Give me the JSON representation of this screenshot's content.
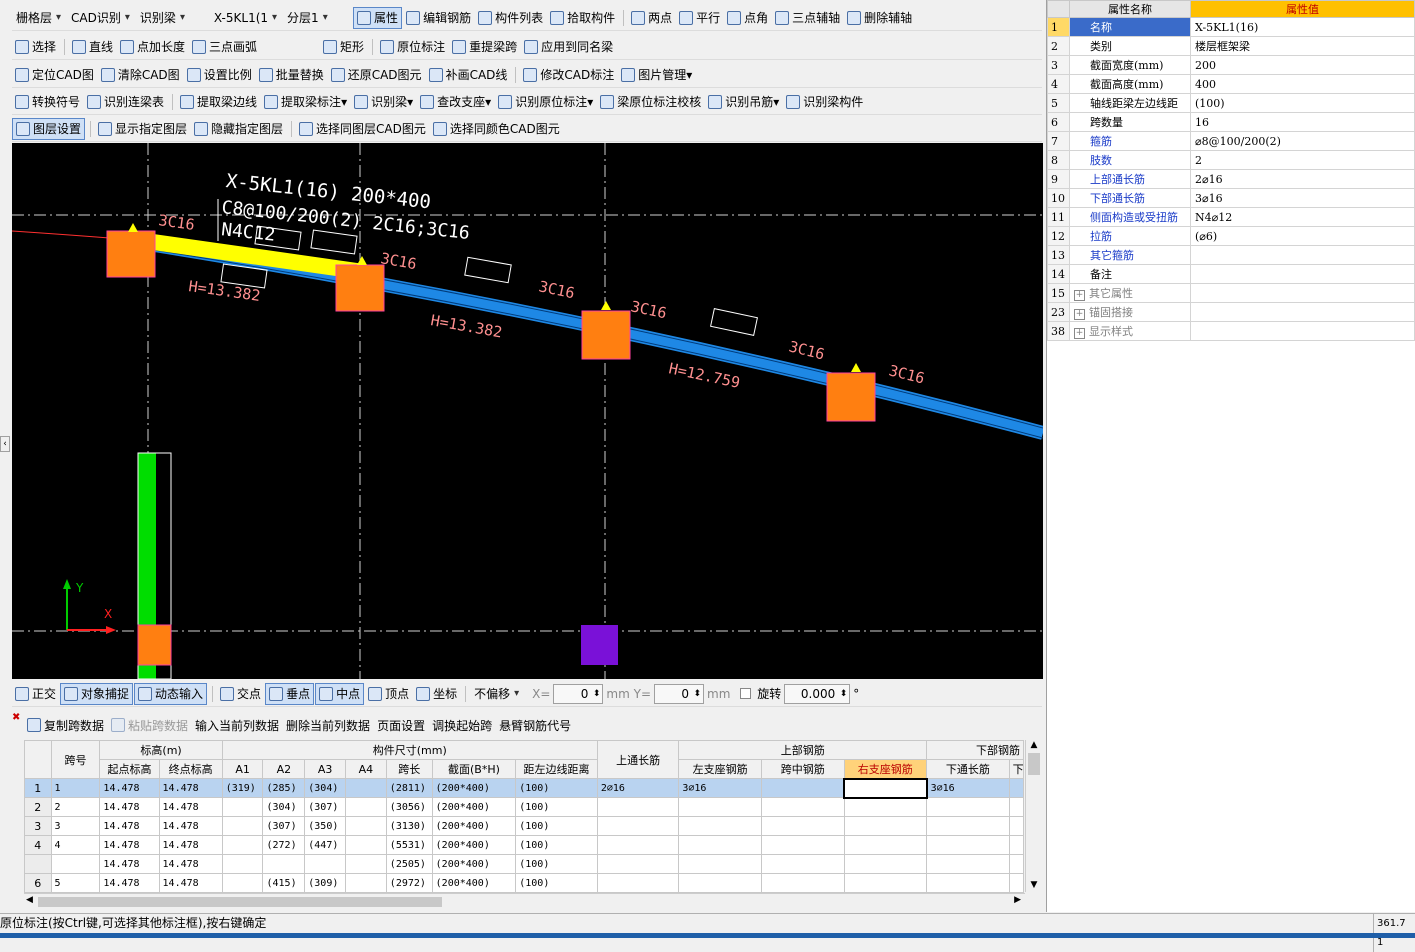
{
  "toolbar1": {
    "floor_group": "栅格层",
    "cad_recognize": "CAD识别",
    "recognize_beam": "识别梁",
    "component": "X-5KL1(1",
    "sublayer": "分层1",
    "attributes": "属性",
    "edit_rebar": "编辑钢筋",
    "component_list": "构件列表",
    "pick_component": "拾取构件",
    "two_points": "两点",
    "parallel": "平行",
    "point_angle": "点角",
    "three_point_axis": "三点辅轴",
    "delete_axis": "删除辅轴"
  },
  "toolbar2": {
    "select": "选择",
    "line": "直线",
    "point_length": "点加长度",
    "three_point_arc": "三点画弧",
    "rect": "矩形",
    "original_mark": "原位标注",
    "re_extract_span": "重提梁跨",
    "apply_same_name": "应用到同名梁"
  },
  "toolbar3": {
    "locate_cad": "定位CAD图",
    "clear_cad": "清除CAD图",
    "set_scale": "设置比例",
    "batch_replace": "批量替换",
    "restore_cad": "还原CAD图元",
    "redraw_cad_line": "补画CAD线",
    "modify_cad_mark": "修改CAD标注",
    "image_manage": "图片管理"
  },
  "toolbar4": {
    "convert_symbol": "转换符号",
    "recognize_continuous": "识别连梁表",
    "extract_beam_edge": "提取梁边线",
    "extract_beam_mark": "提取梁标注",
    "recognize_beam": "识别梁",
    "check_support": "查改支座",
    "recognize_original": "识别原位标注",
    "beam_check": "梁原位标注校核",
    "recognize_hanger": "识别吊筋",
    "recognize_beam_comp": "识别梁构件"
  },
  "toolbar5": {
    "layer_settings": "图层设置",
    "show_layer": "显示指定图层",
    "hide_layer": "隐藏指定图层",
    "select_same_layer": "选择同图层CAD图元",
    "select_same_color": "选择同颜色CAD图元"
  },
  "cad": {
    "beam_title": "X-5KL1(16) 200*400",
    "stirrup": "C8@100/200(2) 2C16;3C16",
    "side_bars": "N4C12",
    "mark_3c16": "3C16",
    "h1": "H=13.382",
    "h2": "H=13.382",
    "h3": "H=12.759",
    "axis_y": "Y",
    "axis_x": "X",
    "colors": {
      "beam_blue": "#1e88e5",
      "beam_yellow": "#ffff00",
      "column": "#ff7f11",
      "green": "#00dd00",
      "purple": "#7a11d8",
      "text_red": "#ff8080"
    }
  },
  "snapbar": {
    "orthogonal": "正交",
    "object_snap": "对象捕捉",
    "dynamic_input": "动态输入",
    "intersection": "交点",
    "perpendicular": "垂点",
    "midpoint": "中点",
    "vertex": "顶点",
    "coordinate": "坐标",
    "offset": "不偏移",
    "x_label": "X=",
    "x_val": "0",
    "y_label": "Y=",
    "y_val": "0",
    "unit": "mm",
    "rotate": "旋转",
    "rotate_val": "0.000",
    "deg": "°"
  },
  "gridbar": {
    "copy": "复制跨数据",
    "paste": "粘贴跨数据",
    "input_col": "输入当前列数据",
    "delete_col": "删除当前列数据",
    "page_setup": "页面设置",
    "adjust_start": "调换起始跨",
    "cantilever": "悬臂钢筋代号"
  },
  "grid": {
    "headers": {
      "span": "跨号",
      "elevation": "标高(m)",
      "start_elev": "起点标高",
      "end_elev": "终点标高",
      "size": "构件尺寸(mm)",
      "a1": "A1",
      "a2": "A2",
      "a3": "A3",
      "a4": "A4",
      "span_len": "跨长",
      "section": "截面(B*H)",
      "left_dist": "距左边线距离",
      "top_long": "上通长筋",
      "top_bars": "上部钢筋",
      "left_support": "左支座钢筋",
      "mid_span": "跨中钢筋",
      "right_support": "右支座钢筋",
      "bottom_bars": "下部钢筋",
      "bottom_long": "下通长筋",
      "next": "下"
    },
    "rows": [
      {
        "n": "1",
        "span": "1",
        "s": "14.478",
        "e": "14.478",
        "a1": "(319)",
        "a2": "(285)",
        "a3": "(304)",
        "a4": "",
        "len": "(2811)",
        "sec": "(200*400)",
        "dist": "(100)",
        "top": "2⌀16",
        "left": "3⌀16",
        "mid": "",
        "right": "",
        "bot": "3⌀16"
      },
      {
        "n": "2",
        "span": "2",
        "s": "14.478",
        "e": "14.478",
        "a1": "",
        "a2": "(304)",
        "a3": "(307)",
        "a4": "",
        "len": "(3056)",
        "sec": "(200*400)",
        "dist": "(100)",
        "top": "",
        "left": "",
        "mid": "",
        "right": "",
        "bot": ""
      },
      {
        "n": "3",
        "span": "3",
        "s": "14.478",
        "e": "14.478",
        "a1": "",
        "a2": "(307)",
        "a3": "(350)",
        "a4": "",
        "len": "(3130)",
        "sec": "(200*400)",
        "dist": "(100)",
        "top": "",
        "left": "",
        "mid": "",
        "right": "",
        "bot": ""
      },
      {
        "n": "4",
        "span": "4",
        "s": "14.478",
        "e": "14.478",
        "a1": "",
        "a2": "(272)",
        "a3": "(447)",
        "a4": "",
        "len": "(5531)",
        "sec": "(200*400)",
        "dist": "(100)",
        "top": "",
        "left": "",
        "mid": "",
        "right": "",
        "bot": ""
      },
      {
        "n": "",
        "span": "",
        "s": "14.478",
        "e": "14.478",
        "a1": "",
        "a2": "",
        "a3": "",
        "a4": "",
        "len": "(2505)",
        "sec": "(200*400)",
        "dist": "(100)",
        "top": "",
        "left": "",
        "mid": "",
        "right": "",
        "bot": ""
      },
      {
        "n": "6",
        "span": "5",
        "s": "14.478",
        "e": "14.478",
        "a1": "",
        "a2": "(415)",
        "a3": "(309)",
        "a4": "",
        "len": "(2972)",
        "sec": "(200*400)",
        "dist": "(100)",
        "top": "",
        "left": "",
        "mid": "",
        "right": "",
        "bot": ""
      }
    ]
  },
  "props": {
    "header_name": "属性名称",
    "header_value": "属性值",
    "rows": [
      {
        "n": "1",
        "name": "名称",
        "value": "X-5KL1(16)"
      },
      {
        "n": "2",
        "name": "类别",
        "value": "楼层框架梁"
      },
      {
        "n": "3",
        "name": "截面宽度(mm)",
        "value": "200"
      },
      {
        "n": "4",
        "name": "截面高度(mm)",
        "value": "400"
      },
      {
        "n": "5",
        "name": "轴线距梁左边线距",
        "value": "(100)"
      },
      {
        "n": "6",
        "name": "跨数量",
        "value": "16"
      },
      {
        "n": "7",
        "name": "箍筋",
        "value": "⌀8@100/200(2)"
      },
      {
        "n": "8",
        "name": "肢数",
        "value": "2"
      },
      {
        "n": "9",
        "name": "上部通长筋",
        "value": "2⌀16"
      },
      {
        "n": "10",
        "name": "下部通长筋",
        "value": "3⌀16"
      },
      {
        "n": "11",
        "name": "侧面构造或受扭筋",
        "value": "N4⌀12"
      },
      {
        "n": "12",
        "name": "拉筋",
        "value": "(⌀6)"
      },
      {
        "n": "13",
        "name": "其它箍筋",
        "value": ""
      },
      {
        "n": "14",
        "name": "备注",
        "value": ""
      },
      {
        "n": "15",
        "name": "其它属性",
        "value": ""
      },
      {
        "n": "23",
        "name": "锚固搭接",
        "value": ""
      },
      {
        "n": "38",
        "name": "显示样式",
        "value": ""
      }
    ]
  },
  "status": {
    "hint": "原位标注(按Ctrl键,可选择其他标注框),按右键确定",
    "coord": "361.7 1"
  }
}
